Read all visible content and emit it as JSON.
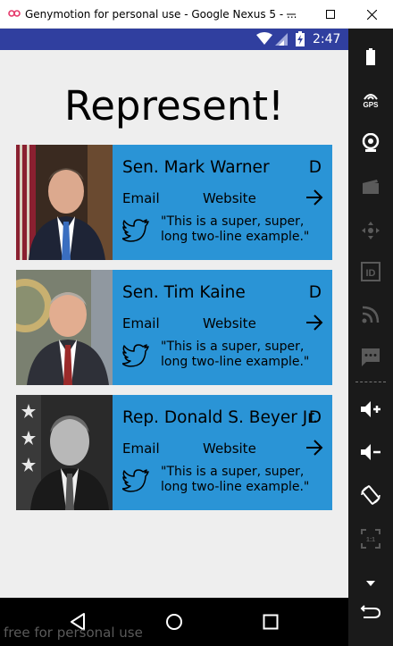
{
  "window": {
    "title": "Genymotion for personal use - Google Nexus 5 - ...",
    "controls": [
      "minimize",
      "maximize",
      "close"
    ]
  },
  "status_bar": {
    "time": "2:47",
    "icons": [
      "wifi-icon",
      "signal-icon",
      "battery-charging-icon"
    ],
    "color": "#303f9f"
  },
  "app": {
    "title": "Represent!",
    "card_color": "#2a94d6",
    "representatives": [
      {
        "name": "Sen. Mark Warner",
        "party": "D",
        "email_label": "Email",
        "website_label": "Website",
        "quote": "\"This is a super, super, long two-line example.\""
      },
      {
        "name": "Sen. Tim Kaine",
        "party": "D",
        "email_label": "Email",
        "website_label": "Website",
        "quote": "\"This is a super, super, long two-line example.\""
      },
      {
        "name": "Rep. Donald S. Beyer Jr.",
        "party": "D",
        "email_label": "Email",
        "website_label": "Website",
        "quote": "\"This is a super, super, long two-line example.\""
      }
    ]
  },
  "nav_bar": {
    "buttons": [
      "back-icon",
      "home-icon",
      "recents-icon"
    ],
    "watermark": "free for personal use"
  },
  "sidebar": {
    "tools": [
      {
        "name": "battery-icon"
      },
      {
        "name": "gps-icon",
        "label": "GPS"
      },
      {
        "name": "webcam-icon"
      },
      {
        "name": "media-icon"
      },
      {
        "name": "dpad-icon"
      },
      {
        "name": "id-icon",
        "label": "ID"
      },
      {
        "name": "rss-icon"
      },
      {
        "name": "sms-icon"
      },
      {
        "name": "volume-up-icon"
      },
      {
        "name": "volume-down-icon"
      },
      {
        "name": "rotate-icon"
      },
      {
        "name": "pixel-perfect-icon",
        "label": "1:1"
      },
      {
        "name": "scroll-down-icon"
      }
    ]
  }
}
